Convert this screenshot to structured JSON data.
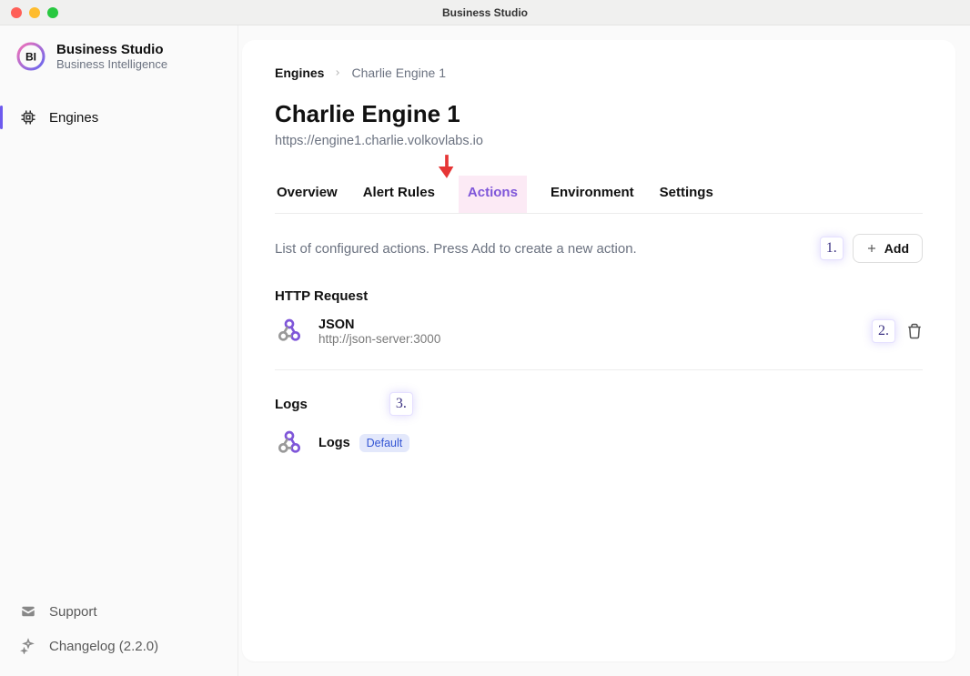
{
  "window": {
    "title": "Business Studio"
  },
  "brand": {
    "title": "Business Studio",
    "subtitle": "Business Intelligence"
  },
  "sidebar": {
    "items": [
      {
        "label": "Engines"
      }
    ],
    "bottom": [
      {
        "label": "Support"
      },
      {
        "label": "Changelog (2.2.0)"
      }
    ]
  },
  "breadcrumb": {
    "root": "Engines",
    "current": "Charlie Engine 1"
  },
  "page": {
    "title": "Charlie Engine 1",
    "subtitle": "https://engine1.charlie.volkovlabs.io"
  },
  "tabs": [
    {
      "label": "Overview"
    },
    {
      "label": "Alert Rules"
    },
    {
      "label": "Actions",
      "active": true
    },
    {
      "label": "Environment"
    },
    {
      "label": "Settings"
    }
  ],
  "actions": {
    "description": "List of configured actions. Press Add to create a new action.",
    "add_label": "Add",
    "groups": [
      {
        "title": "HTTP Request",
        "items": [
          {
            "name": "JSON",
            "sub": "http://json-server:3000"
          }
        ]
      },
      {
        "title": "Logs",
        "items": [
          {
            "name": "Logs",
            "badge": "Default"
          }
        ]
      }
    ]
  },
  "annotations": {
    "step1": "1.",
    "step2": "2.",
    "step3": "3."
  }
}
